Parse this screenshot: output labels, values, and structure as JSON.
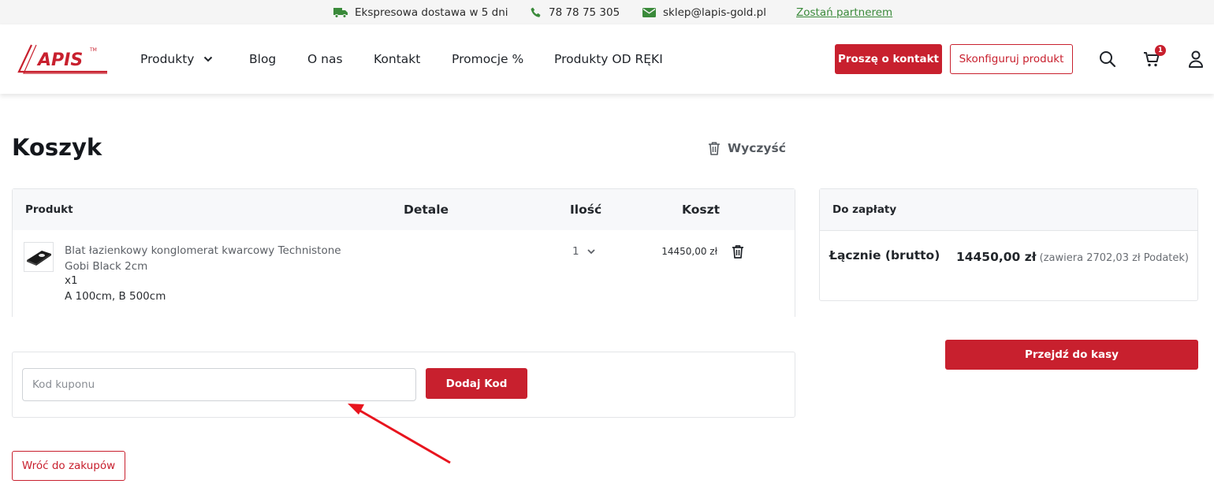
{
  "topbar": {
    "delivery": "Ekspresowa dostawa w 5 dni",
    "phone": "78 78 75 305",
    "email": "sklep@lapis-gold.pl",
    "partner": "Zostań partnerem",
    "icon_color": "#3a8a3a"
  },
  "header": {
    "logo_text": "APIS",
    "logo_mark": "TM",
    "nav": [
      "Produkty",
      "Blog",
      "O nas",
      "Kontakt",
      "Promocje %",
      "Produkty OD RĘKI"
    ],
    "contact_button": "Proszę o kontakt",
    "config_button": "Skonfiguruj produkt",
    "cart_count": "1",
    "icons": [
      "search-icon",
      "cart-icon",
      "user-icon"
    ],
    "accent_color": "#c8202e"
  },
  "cart": {
    "title": "Koszyk",
    "clear_label": "Wyczyść",
    "columns": {
      "product": "Produkt",
      "details": "Detale",
      "quantity": "Ilość",
      "cost": "Koszt"
    },
    "items": [
      {
        "name": "Blat łazienkowy konglomerat kwarcowy Technistone Gobi Black 2cm",
        "multiplier": "x1",
        "dimensions": "A 100cm, B 500cm",
        "quantity": "1",
        "price": "14450,00 zł"
      }
    ]
  },
  "coupon": {
    "placeholder": "Kod kuponu",
    "value": "",
    "button": "Dodaj Kod"
  },
  "back_button": "Wróć do zakupów",
  "summary": {
    "title": "Do zapłaty",
    "total_label": "Łącznie (brutto)",
    "total_value": "14450,00 zł",
    "tax_note": "(zawiera 2702,03 zł Podatek)",
    "checkout_button": "Przejdź do kasy"
  }
}
